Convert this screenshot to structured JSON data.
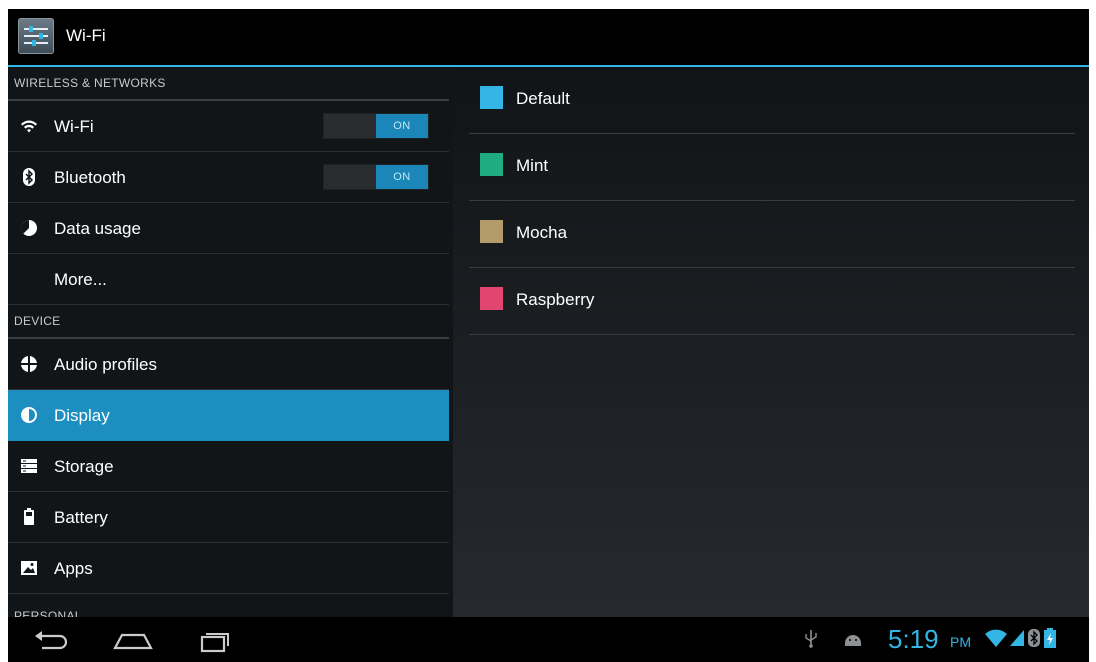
{
  "action_bar": {
    "title": "Wi-Fi",
    "icon": "settings-app-icon"
  },
  "settings_list": {
    "wireless_header": "WIRELESS & NETWORKS",
    "wifi": {
      "label": "Wi-Fi",
      "toggle": "ON",
      "icon": "wifi-icon"
    },
    "bluetooth": {
      "label": "Bluetooth",
      "toggle": "ON",
      "icon": "bluetooth-icon"
    },
    "data_usage": {
      "label": "Data usage",
      "icon": "data-usage-icon"
    },
    "more": {
      "label": "More..."
    },
    "device_header": "DEVICE",
    "audio_profiles": {
      "label": "Audio profiles",
      "icon": "audio-profiles-icon"
    },
    "display": {
      "label": "Display",
      "icon": "display-icon",
      "selected": true
    },
    "storage": {
      "label": "Storage",
      "icon": "storage-icon"
    },
    "battery": {
      "label": "Battery",
      "icon": "battery-icon"
    },
    "apps": {
      "label": "Apps",
      "icon": "apps-icon"
    },
    "personal_header": "PERSONAL"
  },
  "color_options": [
    {
      "label": "Default",
      "color": "#33b5e5"
    },
    {
      "label": "Mint",
      "color": "#1eac80"
    },
    {
      "label": "Mocha",
      "color": "#b39b6a"
    },
    {
      "label": "Raspberry",
      "color": "#e0466f"
    }
  ],
  "status_bar": {
    "time": "5:19",
    "ampm": "PM",
    "accent_color": "#33b5e5",
    "icons": [
      "usb-icon",
      "android-debug-icon",
      "wifi-signal-icon",
      "cell-signal-icon",
      "bluetooth-status-icon",
      "battery-status-icon"
    ]
  },
  "nav_bar": {
    "buttons": [
      "back-button",
      "home-button",
      "recent-apps-button"
    ]
  }
}
